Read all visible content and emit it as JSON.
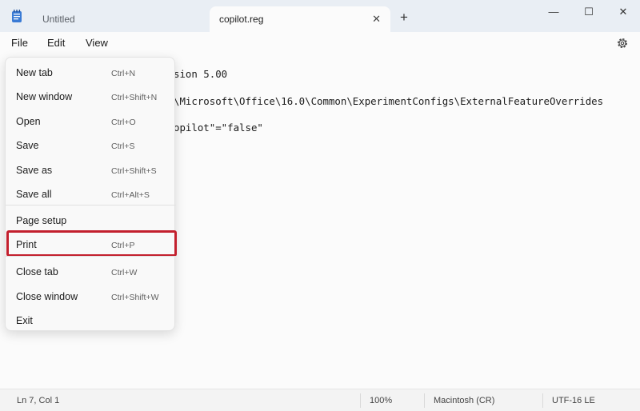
{
  "tabs": [
    {
      "label": "Untitled"
    },
    {
      "label": "copilot.reg"
    }
  ],
  "window_controls": {
    "minimize": "—",
    "maximize": "☐",
    "close": "✕"
  },
  "new_tab_glyph": "+",
  "tab_close_glyph": "✕",
  "menubar": {
    "file": "File",
    "edit": "Edit",
    "view": "View"
  },
  "editor": {
    "lines": [
      "sion 5.00",
      "\\Microsoft\\Office\\16.0\\Common\\ExperimentConfigs\\ExternalFeatureOverrides",
      "opilot\"=\"false\""
    ]
  },
  "file_menu": {
    "items": [
      {
        "label": "New tab",
        "shortcut": "Ctrl+N"
      },
      {
        "label": "New window",
        "shortcut": "Ctrl+Shift+N"
      },
      {
        "label": "Open",
        "shortcut": "Ctrl+O"
      },
      {
        "label": "Save",
        "shortcut": "Ctrl+S"
      },
      {
        "label": "Save as",
        "shortcut": "Ctrl+Shift+S"
      },
      {
        "label": "Save all",
        "shortcut": "Ctrl+Alt+S"
      },
      {
        "label": "Page setup",
        "shortcut": ""
      },
      {
        "label": "Print",
        "shortcut": "Ctrl+P"
      },
      {
        "label": "Close tab",
        "shortcut": "Ctrl+W"
      },
      {
        "label": "Close window",
        "shortcut": "Ctrl+Shift+W"
      },
      {
        "label": "Exit",
        "shortcut": ""
      }
    ],
    "highlighted_item": "Print",
    "highlight_color": "#c3202e"
  },
  "statusbar": {
    "position": "Ln 7, Col 1",
    "zoom": "100%",
    "line_ending": "Macintosh (CR)",
    "encoding": "UTF-16 LE"
  },
  "icons": {
    "app": "notepad-icon",
    "settings": "gear-icon"
  }
}
